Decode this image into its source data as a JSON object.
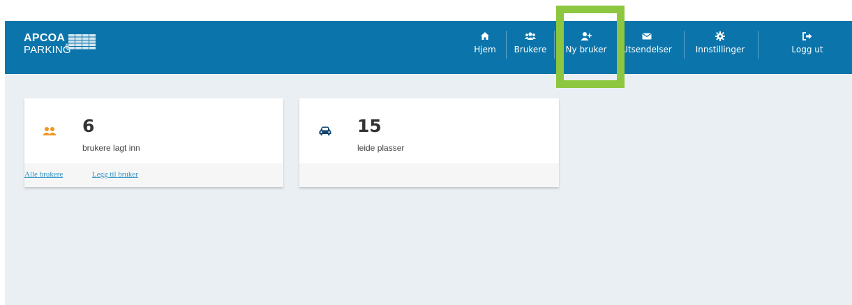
{
  "brand": {
    "line1": "APCOA",
    "line2": "PARKING"
  },
  "nav": [
    {
      "label": "Hjem",
      "icon": "home-icon"
    },
    {
      "label": "Brukere",
      "icon": "users-icon"
    },
    {
      "label": "Ny bruker",
      "icon": "user-plus-icon"
    },
    {
      "label": "Utsendelser",
      "icon": "envelope-icon"
    },
    {
      "label": "Innstillinger",
      "icon": "gear-icon"
    },
    {
      "label": "Logg ut",
      "icon": "sign-out-icon"
    }
  ],
  "cards": {
    "users": {
      "count": "6",
      "caption": "brukere lagt inn",
      "icon": "users-icon",
      "links": [
        "Alle brukere",
        "Legg til bruker"
      ]
    },
    "spaces": {
      "count": "15",
      "caption": "leide plasser",
      "icon": "car-icon"
    }
  },
  "colors": {
    "topbar": "#0b75ab",
    "background": "#eaeff3",
    "highlight": "#8dc63f",
    "accent_orange": "#f0951e",
    "link": "#2e93c6"
  }
}
